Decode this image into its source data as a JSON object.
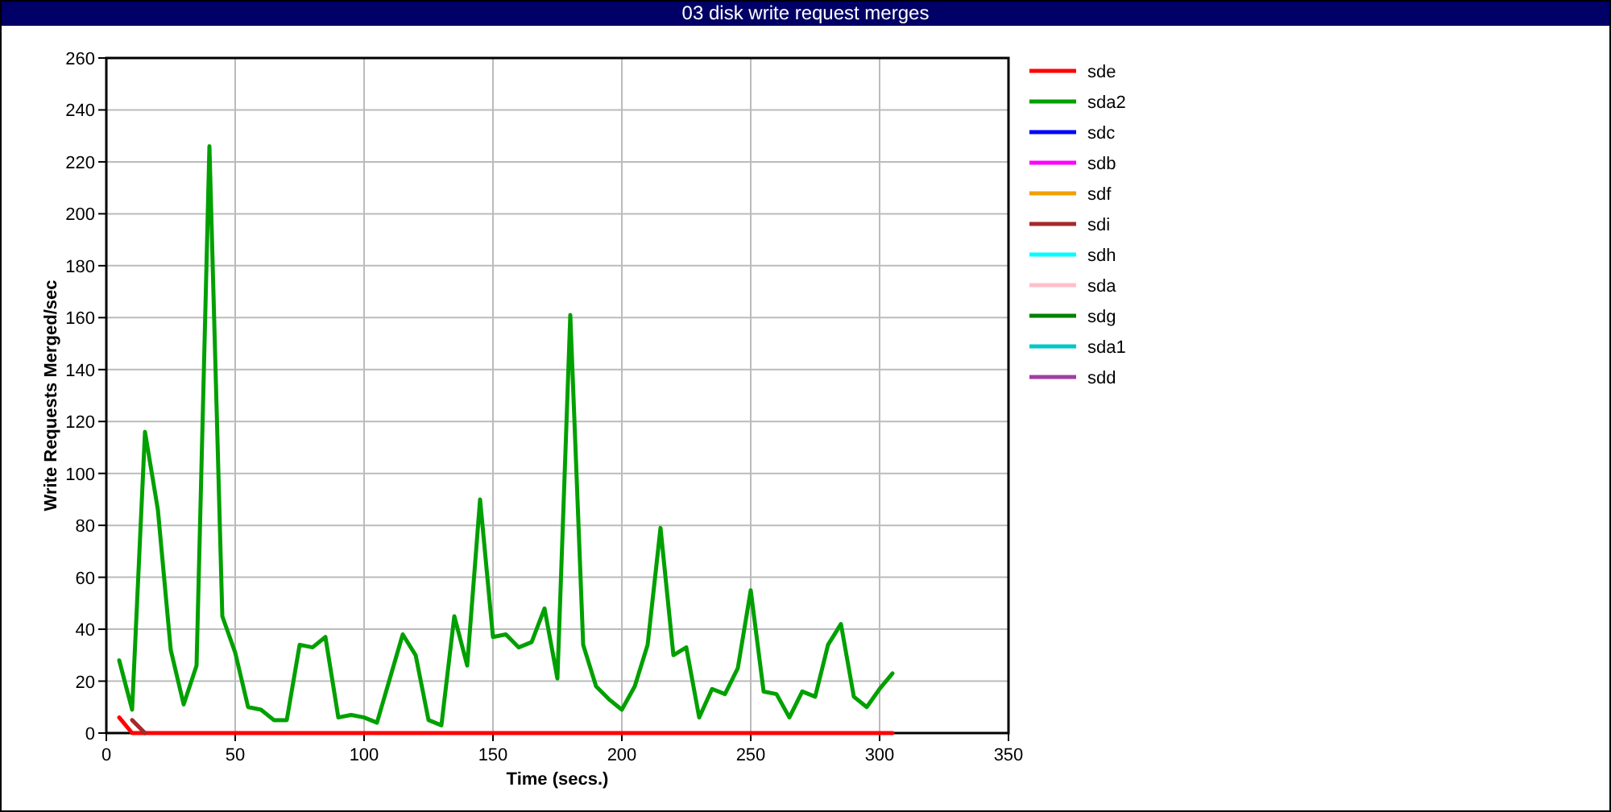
{
  "title": "03 disk write request merges",
  "chart": {
    "chart_data": {
      "type": "line",
      "grid": true,
      "legend": true,
      "xlabel": "Time (secs.)",
      "ylabel": "Write Requests Merged/sec",
      "xlim": [
        0,
        350
      ],
      "ylim": [
        0,
        260
      ],
      "xticks": [
        0,
        50,
        100,
        150,
        200,
        250,
        300,
        350
      ],
      "yticks": [
        0,
        20,
        40,
        60,
        80,
        100,
        120,
        140,
        160,
        180,
        200,
        220,
        240,
        260
      ],
      "x": [
        5,
        10,
        15,
        20,
        25,
        30,
        35,
        40,
        45,
        50,
        55,
        60,
        65,
        70,
        75,
        80,
        85,
        90,
        95,
        100,
        105,
        110,
        115,
        120,
        125,
        130,
        135,
        140,
        145,
        150,
        155,
        160,
        165,
        170,
        175,
        180,
        185,
        190,
        195,
        200,
        205,
        210,
        215,
        220,
        225,
        230,
        235,
        240,
        245,
        250,
        255,
        260,
        265,
        270,
        275,
        280,
        285,
        290,
        295,
        300,
        305
      ],
      "series": [
        {
          "name": "sde",
          "color": "#ff0000",
          "values": [
            6,
            0,
            0,
            0,
            0,
            0,
            0,
            0,
            0,
            0,
            0,
            0,
            0,
            0,
            0,
            0,
            0,
            0,
            0,
            0,
            0,
            0,
            0,
            0,
            0,
            0,
            0,
            0,
            0,
            0,
            0,
            0,
            0,
            0,
            0,
            0,
            0,
            0,
            0,
            0,
            0,
            0,
            0,
            0,
            0,
            0,
            0,
            0,
            0,
            0,
            0,
            0,
            0,
            0,
            0,
            0,
            0,
            0,
            0,
            0,
            0
          ]
        },
        {
          "name": "sda2",
          "color": "#00a000",
          "values": [
            28,
            9,
            116,
            86,
            32,
            11,
            26,
            226,
            45,
            31,
            10,
            9,
            5,
            5,
            34,
            33,
            37,
            6,
            7,
            6,
            4,
            21,
            38,
            30,
            5,
            3,
            45,
            26,
            90,
            37,
            38,
            33,
            35,
            48,
            21,
            161,
            34,
            18,
            13,
            9,
            18,
            34,
            79,
            30,
            33,
            6,
            17,
            15,
            25,
            55,
            16,
            15,
            6,
            16,
            14,
            34,
            42,
            14,
            10,
            17,
            23
          ]
        },
        {
          "name": "sdc",
          "color": "#0000ff",
          "values": [
            null,
            null,
            null,
            null,
            null,
            null,
            null,
            null,
            null,
            null,
            null,
            null,
            null,
            null,
            null,
            null,
            null,
            null,
            null,
            null,
            null,
            null,
            null,
            null,
            null,
            null,
            null,
            null,
            null,
            null,
            null,
            null,
            null,
            null,
            null,
            null,
            null,
            null,
            null,
            null,
            null,
            null,
            null,
            null,
            null,
            null,
            null,
            null,
            null,
            null,
            null,
            null,
            null,
            null,
            null,
            null,
            null,
            null,
            null,
            null,
            null
          ]
        },
        {
          "name": "sdb",
          "color": "#ff00ff",
          "values": [
            null,
            null,
            null,
            null,
            null,
            null,
            null,
            null,
            null,
            null,
            null,
            null,
            null,
            null,
            null,
            null,
            null,
            null,
            null,
            null,
            null,
            null,
            null,
            null,
            null,
            null,
            null,
            null,
            null,
            null,
            null,
            null,
            null,
            null,
            null,
            null,
            null,
            null,
            null,
            null,
            null,
            null,
            null,
            null,
            null,
            null,
            null,
            null,
            null,
            null,
            null,
            null,
            null,
            null,
            null,
            null,
            null,
            null,
            null,
            null,
            null
          ]
        },
        {
          "name": "sdf",
          "color": "#f0a000",
          "values": [
            null,
            null,
            null,
            null,
            null,
            null,
            null,
            null,
            null,
            null,
            null,
            null,
            null,
            null,
            null,
            null,
            null,
            null,
            null,
            null,
            null,
            null,
            null,
            null,
            null,
            null,
            null,
            null,
            null,
            null,
            null,
            null,
            null,
            null,
            null,
            null,
            null,
            null,
            null,
            null,
            null,
            null,
            null,
            null,
            null,
            null,
            null,
            null,
            null,
            null,
            null,
            null,
            null,
            null,
            null,
            null,
            null,
            null,
            null,
            null,
            null
          ]
        },
        {
          "name": "sdi",
          "color": "#a52a2a",
          "values": [
            null,
            5,
            0,
            null,
            null,
            null,
            null,
            null,
            null,
            null,
            null,
            null,
            null,
            null,
            null,
            null,
            null,
            null,
            null,
            null,
            null,
            null,
            null,
            null,
            null,
            null,
            null,
            null,
            null,
            null,
            null,
            null,
            null,
            null,
            null,
            null,
            null,
            null,
            null,
            null,
            null,
            null,
            null,
            null,
            null,
            null,
            null,
            null,
            null,
            null,
            null,
            null,
            null,
            null,
            null,
            null,
            null,
            null,
            null,
            null,
            null
          ]
        },
        {
          "name": "sdh",
          "color": "#00ffff",
          "values": [
            null,
            null,
            null,
            null,
            null,
            null,
            null,
            null,
            null,
            null,
            null,
            null,
            null,
            null,
            null,
            null,
            null,
            null,
            null,
            null,
            null,
            null,
            null,
            null,
            null,
            null,
            null,
            null,
            null,
            null,
            null,
            null,
            null,
            null,
            null,
            null,
            null,
            null,
            null,
            null,
            null,
            null,
            null,
            null,
            null,
            null,
            null,
            null,
            null,
            null,
            null,
            null,
            null,
            null,
            null,
            null,
            null,
            null,
            null,
            null,
            null
          ]
        },
        {
          "name": "sda",
          "color": "#ffc0cb",
          "values": [
            null,
            null,
            null,
            null,
            null,
            null,
            null,
            null,
            null,
            null,
            null,
            null,
            null,
            null,
            null,
            null,
            null,
            null,
            null,
            null,
            null,
            null,
            null,
            null,
            null,
            null,
            null,
            null,
            null,
            null,
            null,
            null,
            null,
            null,
            null,
            null,
            null,
            null,
            null,
            null,
            null,
            null,
            null,
            null,
            null,
            null,
            null,
            null,
            null,
            null,
            null,
            null,
            null,
            null,
            null,
            null,
            null,
            null,
            null,
            null,
            null
          ]
        },
        {
          "name": "sdg",
          "color": "#008000",
          "values": [
            null,
            null,
            null,
            null,
            null,
            null,
            null,
            null,
            null,
            null,
            null,
            null,
            null,
            null,
            null,
            null,
            null,
            null,
            null,
            null,
            null,
            null,
            null,
            null,
            null,
            null,
            null,
            null,
            null,
            null,
            null,
            null,
            null,
            null,
            null,
            null,
            null,
            null,
            null,
            null,
            null,
            null,
            null,
            null,
            null,
            null,
            null,
            null,
            null,
            null,
            null,
            null,
            null,
            null,
            null,
            null,
            null,
            null,
            null,
            null,
            null
          ]
        },
        {
          "name": "sda1",
          "color": "#00c8c8",
          "values": [
            null,
            null,
            null,
            null,
            null,
            null,
            null,
            null,
            null,
            null,
            null,
            null,
            null,
            null,
            null,
            null,
            null,
            null,
            null,
            null,
            null,
            null,
            null,
            null,
            null,
            null,
            null,
            null,
            null,
            null,
            null,
            null,
            null,
            null,
            null,
            null,
            null,
            null,
            null,
            null,
            null,
            null,
            null,
            null,
            null,
            null,
            null,
            null,
            null,
            null,
            null,
            null,
            null,
            null,
            null,
            null,
            null,
            null,
            null,
            null,
            null
          ]
        },
        {
          "name": "sdd",
          "color": "#a040a0",
          "values": [
            null,
            null,
            null,
            null,
            null,
            null,
            null,
            null,
            null,
            null,
            null,
            null,
            null,
            null,
            null,
            null,
            null,
            null,
            null,
            null,
            null,
            null,
            null,
            null,
            null,
            null,
            null,
            null,
            null,
            null,
            null,
            null,
            null,
            null,
            null,
            null,
            null,
            null,
            null,
            null,
            null,
            null,
            null,
            null,
            null,
            null,
            null,
            null,
            null,
            null,
            null,
            null,
            null,
            null,
            null,
            null,
            null,
            null,
            null,
            null,
            null
          ]
        }
      ]
    }
  }
}
